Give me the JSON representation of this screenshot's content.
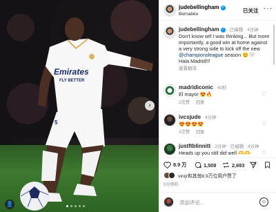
{
  "post": {
    "author": "judebellingham",
    "location": "Bernabéu",
    "follow_label": "已关注",
    "more_label": "···"
  },
  "caption": {
    "author": "judebellingham",
    "meta": "· 已编辑 · 4分钟",
    "text_1": "Don't know wtf I was thinking... But more importantly, a good win at home against a very strong side to kick off the new ",
    "hashtag": "@championsleague",
    "text_2": " season 😊🤍",
    "text_3": "Hala Madrid!!!",
    "translate": "查看翻译"
  },
  "comments": [
    {
      "author": "madridiconic",
      "meta": "· 40秒",
      "text": "El mayor 😍🔥",
      "likes": "2次赞",
      "reply": "回复"
    },
    {
      "author": "ivcsjude",
      "meta": "· 4分钟",
      "text": "😍😍😍😍",
      "likes": "3次赞",
      "reply": "回复"
    },
    {
      "author": "justftblinnitt",
      "meta": "· 2分钟 · 已编辑 · 4分钟",
      "text": "Heads up you still did well 🫶🫶"
    }
  ],
  "actions": {
    "likes": "8.9 万",
    "comments": "1,508",
    "shares": "2,693"
  },
  "liked_by": "vinijr和其他8.9万位用户赞了",
  "timestamp": "5分钟前",
  "composer": {
    "placeholder": "添加评论..."
  },
  "photo": {
    "jersey_sponsor": "Emirates",
    "jersey_sub": "FLY BETTER",
    "shirt_number": "5",
    "carousel_count": 5,
    "carousel_active": 0
  },
  "icons": {
    "next": "chevron-right-icon",
    "like": "heart-icon",
    "comment": "speech-bubble-icon",
    "repost": "repost-icon",
    "share": "send-icon",
    "save": "bookmark-icon",
    "emoji": "smiley-icon"
  },
  "colors": {
    "verified": "#0095f6",
    "link": "#00376b",
    "muted": "#8e8e8e"
  }
}
